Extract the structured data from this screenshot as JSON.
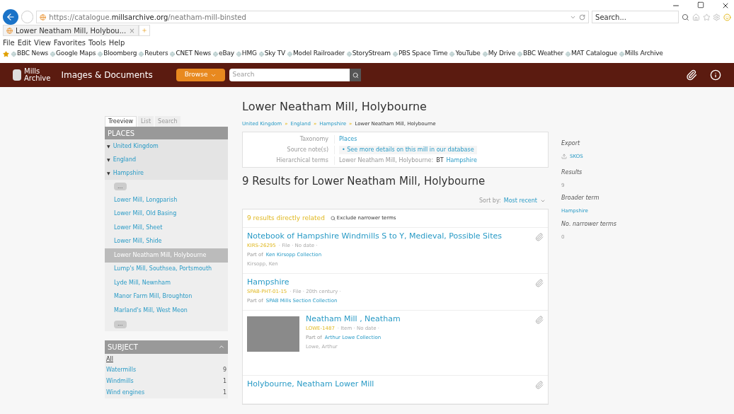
{
  "browser": {
    "url_prefix": "https://catalogue.",
    "url_domain": "millsarchive.org",
    "url_path": "/neatham-mill-binsted",
    "search_placeholder": "Search...",
    "tab_title": "Lower Neatham Mill, Holybou...",
    "tab_close": "×",
    "menu": [
      "File",
      "Edit",
      "View",
      "Favorites",
      "Tools",
      "Help"
    ],
    "favorites": [
      "BBC News",
      "Google Maps",
      "Bloomberg",
      "Reuters",
      "CNET News",
      "eBay",
      "HMG",
      "Sky TV",
      "Model Railroader",
      "StoryStream",
      "PBS Space Time",
      "YouTube",
      "My Drive",
      "BBC Weather",
      "MAT Catalogue",
      "Mills Archive"
    ]
  },
  "site": {
    "logo_line1": "Mills",
    "logo_line2": "Archive",
    "title": "Images & Documents",
    "browse": "Browse",
    "search_placeholder": "Search"
  },
  "sidebar": {
    "tabs": [
      {
        "label": "Treeview",
        "selected": true
      },
      {
        "label": "List",
        "selected": false
      },
      {
        "label": "Search",
        "selected": false
      }
    ],
    "places_heading": "PLACES",
    "tree": [
      {
        "label": "United Kingdom",
        "toggle": "▼"
      },
      {
        "label": "England",
        "toggle": "▼"
      },
      {
        "label": "Hampshire",
        "toggle": "▼"
      }
    ],
    "more": "...",
    "items": [
      {
        "label": "Lower Mill, Longparish",
        "selected": false
      },
      {
        "label": "Lower Mill, Old Basing",
        "selected": false
      },
      {
        "label": "Lower Mill, Sheet",
        "selected": false
      },
      {
        "label": "Lower Mill, Shide",
        "selected": false
      },
      {
        "label": "Lower Neatham Mill, Holybourne",
        "selected": true
      },
      {
        "label": "Lump's Mill, Southsea, Portsmouth",
        "selected": false
      },
      {
        "label": "Lyde Mill, Newnham",
        "selected": false
      },
      {
        "label": "Manor Farm Mill, Broughton",
        "selected": false
      },
      {
        "label": "Marland's Mill, West Meon",
        "selected": false
      }
    ],
    "more_after": "...",
    "subject_heading": "SUBJECT",
    "subject_expanded": true,
    "subject_all": "All",
    "subjects": [
      {
        "label": "Watermills",
        "count": "9"
      },
      {
        "label": "Windmills",
        "count": "1"
      },
      {
        "label": "Wind engines",
        "count": "1"
      }
    ]
  },
  "main": {
    "title": "Lower Neatham Mill, Holybourne",
    "breadcrumb": [
      {
        "label": "United Kingdom"
      },
      {
        "label": "England"
      },
      {
        "label": "Hampshire"
      },
      {
        "label": "Lower Neatham Mill, Holybourne"
      }
    ],
    "breadcrumb_sep": "»",
    "fields": [
      {
        "label": "Taxonomy",
        "kind": "link",
        "value": "Places"
      },
      {
        "label": "Source note(s)",
        "kind": "bullet",
        "bullet": "•",
        "value": "See more details on this mill in our database"
      },
      {
        "label": "Hierarchical terms",
        "kind": "term",
        "value": "Lower Neatham Mill, Holybourne:",
        "bt": "BT",
        "link": "Hampshire"
      }
    ],
    "results_title": "9 Results for Lower Neatham Mill, Holybourne",
    "sort_label": "Sort by:",
    "sort_value": "Most recent",
    "related": "9 results directly related",
    "exclude": "Exclude narrower terms",
    "results": [
      {
        "title": "Notebook of Hampshire Windmills S to Y, Medieval, Possible Sites",
        "ref": "KIRS-26295",
        "meta": "· File · No date ·",
        "part_of": "Part of",
        "collection": "Ken Kirsopp Collection",
        "creator": "Kirsopp, Ken",
        "has_image": false
      },
      {
        "title": "Hampshire",
        "ref": "SPAB-PHT-01-15",
        "meta": "· File · 20th century ·",
        "part_of": "Part of",
        "collection": "SPAB Mills Section Collection",
        "has_image": false
      },
      {
        "title": "Neatham Mill , Neatham",
        "ref": "LOWE-1487",
        "meta": "· Item · No date ·",
        "part_of": "Part of",
        "collection": "Arthur Lowe Collection",
        "creator": "Lowe, Arthur",
        "has_image": true
      },
      {
        "title": "Holybourne, Neatham Lower Mill",
        "has_image": false
      }
    ]
  },
  "aside": {
    "export_label": "Export",
    "export_link": "SKOS",
    "results_label": "Results",
    "results_value": "9",
    "broader_label": "Broader term",
    "broader_link": "Hampshire",
    "narrower_label": "No. narrower terms",
    "narrower_value": "0"
  }
}
